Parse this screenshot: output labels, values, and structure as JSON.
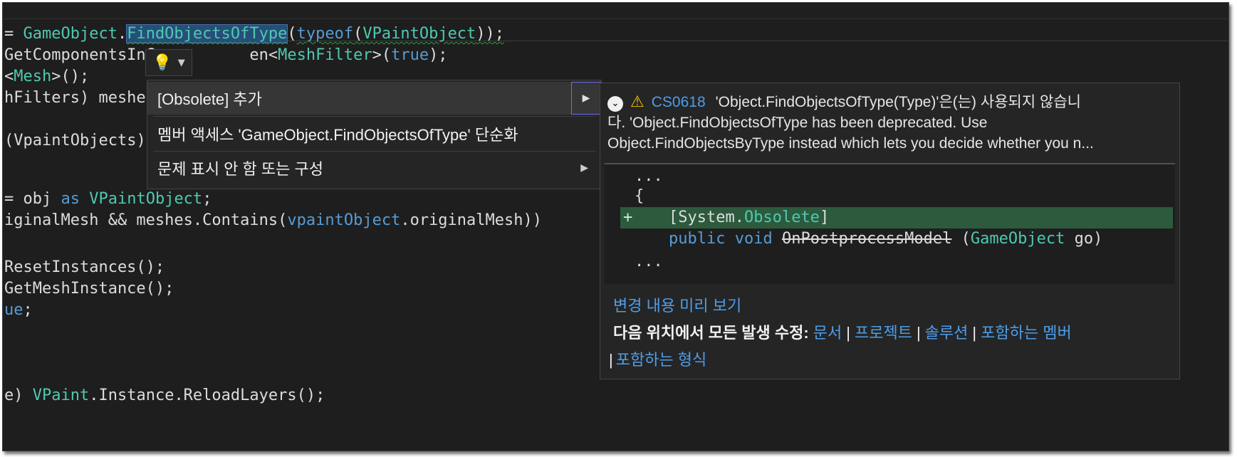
{
  "editor": {
    "lines": [
      {
        "parts": [
          [
            "= ",
            ""
          ],
          [
            "GameObject",
            "ty"
          ],
          [
            ".",
            ""
          ],
          [
            "FindObjectsOfType",
            "sel"
          ],
          [
            "(",
            ""
          ],
          [
            "typeof",
            "kw"
          ],
          [
            "(",
            ""
          ],
          [
            "VPaintObject",
            "ty"
          ],
          [
            "));",
            ""
          ]
        ]
      },
      {
        "parts": [
          [
            "GetComponentsInC",
            ""
          ],
          [
            "          ",
            ""
          ],
          [
            "en<",
            ""
          ],
          [
            "MeshFilter",
            "ty"
          ],
          [
            ">(",
            ""
          ],
          [
            "true",
            "kw"
          ],
          [
            ");",
            ""
          ]
        ]
      },
      {
        "parts": [
          [
            "<",
            ""
          ],
          [
            "Mesh",
            "ty"
          ],
          [
            ">();",
            ""
          ]
        ]
      },
      {
        "parts": [
          [
            "hFilters) meshes",
            ""
          ]
        ]
      },
      {
        "parts": [
          [
            "",
            ""
          ]
        ]
      },
      {
        "parts": [
          [
            "(",
            ""
          ],
          [
            "VpaintObjects",
            ""
          ],
          [
            ")",
            ""
          ]
        ]
      },
      {
        "parts": [
          [
            "",
            ""
          ]
        ]
      },
      {
        "parts": [
          [
            "= obj ",
            ""
          ],
          [
            "as",
            "kw"
          ],
          [
            " ",
            ""
          ],
          [
            "VPaintObject",
            "ty"
          ],
          [
            ";",
            ""
          ]
        ]
      },
      {
        "parts": [
          [
            "iginalMesh && meshes.",
            ""
          ],
          [
            "Contains",
            ""
          ],
          [
            "(",
            ""
          ],
          [
            "vpaintObject",
            "kw"
          ],
          [
            ".originalMesh))",
            ""
          ]
        ]
      },
      {
        "parts": [
          [
            "",
            ""
          ]
        ]
      },
      {
        "parts": [
          [
            "ResetInstances();",
            ""
          ]
        ]
      },
      {
        "parts": [
          [
            "GetMeshInstance();",
            ""
          ]
        ]
      },
      {
        "parts": [
          [
            "ue",
            "kw"
          ],
          [
            ";",
            ""
          ]
        ]
      },
      {
        "parts": [
          [
            "",
            ""
          ]
        ]
      },
      {
        "parts": [
          [
            "",
            ""
          ]
        ]
      },
      {
        "parts": [
          [
            "",
            ""
          ]
        ]
      },
      {
        "parts": [
          [
            "e) ",
            ""
          ],
          [
            "VPaint",
            "ty"
          ],
          [
            ".Instance.ReloadLayers();",
            ""
          ]
        ]
      }
    ]
  },
  "lightbulb": {
    "icon": "lightbulb-icon",
    "dropdown_icon": "caret-down-icon"
  },
  "menu": {
    "items": [
      {
        "label": "[Obsolete] 추가",
        "has_submenu": true,
        "active": true
      },
      {
        "label": "멤버 액세스 'GameObject.FindObjectsOfType' 단순화",
        "has_submenu": false,
        "active": false
      },
      {
        "label": "문제 표시 안 함 또는 구성",
        "has_submenu": true,
        "active": false
      }
    ]
  },
  "preview": {
    "error_code": "CS0618",
    "message_line1": "'Object.FindObjectsOfType(Type)'은(는) 사용되지 않습니",
    "message_line2": "다. 'Object.FindObjectsOfType has been deprecated. Use",
    "message_line3": "Object.FindObjectsByType instead which lets you decide whether you n...",
    "diff": {
      "ellipsis_top": "...",
      "brace": "{",
      "added_prefix": "[System.",
      "added_attr": "Obsolete",
      "added_suffix": "]",
      "plus": "+",
      "method_kw1": "public",
      "method_kw2": "void",
      "method_name": "OnPostprocessModel",
      "method_paren_open": " (",
      "param_type": "GameObject",
      "param_name": " go",
      "method_paren_close": ")",
      "ellipsis_bottom": "..."
    },
    "preview_link": "변경 내용 미리 보기",
    "fix_all_label": "다음 위치에서 모든 발생 수정:",
    "scopes": [
      "문서",
      "프로젝트",
      "솔루션",
      "포함하는 멤버",
      "포함하는 형식"
    ],
    "separator": "|"
  },
  "colors": {
    "editor_bg": "#1e1e1e",
    "keyword": "#569cd6",
    "type": "#4ec9b0",
    "link": "#4d9ee8",
    "diff_added_bg": "#2d5a3d",
    "warning": "#f0c000"
  }
}
